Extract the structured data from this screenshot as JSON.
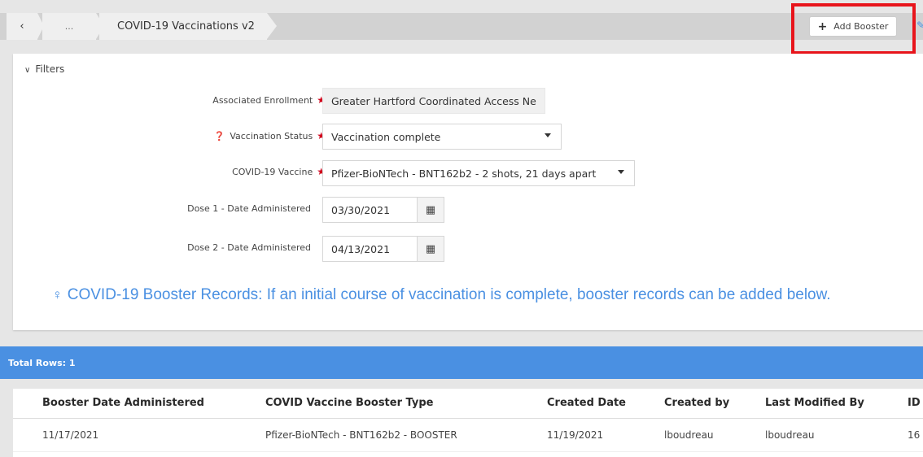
{
  "breadcrumb": {
    "back": "‹",
    "ellipsis": "...",
    "title": "COVID-19 Vaccinations v2"
  },
  "toolbar": {
    "add_booster_label": "Add Booster",
    "add_icon": "plus-icon"
  },
  "filters": {
    "toggle_label": "Filters",
    "associated_enrollment": {
      "label": "Associated Enrollment",
      "value": "Greater Hartford Coordinated Access Ne"
    },
    "vaccination_status": {
      "label": "Vaccination Status",
      "value": "Vaccination complete"
    },
    "covid_vaccine": {
      "label": "COVID-19 Vaccine",
      "value": "Pfizer-BioNTech - BNT162b2 - 2 shots, 21 days apart"
    },
    "dose1": {
      "label": "Dose 1 - Date Administered",
      "value": "03/30/2021"
    },
    "dose2": {
      "label": "Dose 2 - Date Administered",
      "value": "04/13/2021"
    },
    "booster_info": "COVID-19 Booster Records: If an initial course of vaccination is complete, booster records can be added below."
  },
  "total_rows": "Total Rows: 1",
  "table": {
    "headers": [
      "Booster Date Administered",
      "COVID Vaccine Booster Type",
      "Created Date",
      "Created by",
      "Last Modified By",
      "ID"
    ],
    "rows": [
      [
        "11/17/2021",
        "Pfizer-BioNTech - BNT162b2 - BOOSTER",
        "11/19/2021",
        "lboudreau",
        "lboudreau",
        "16"
      ]
    ]
  },
  "colors": {
    "accent": "#4a90e2",
    "highlight": "#e8141b",
    "required": "#d0021b"
  }
}
